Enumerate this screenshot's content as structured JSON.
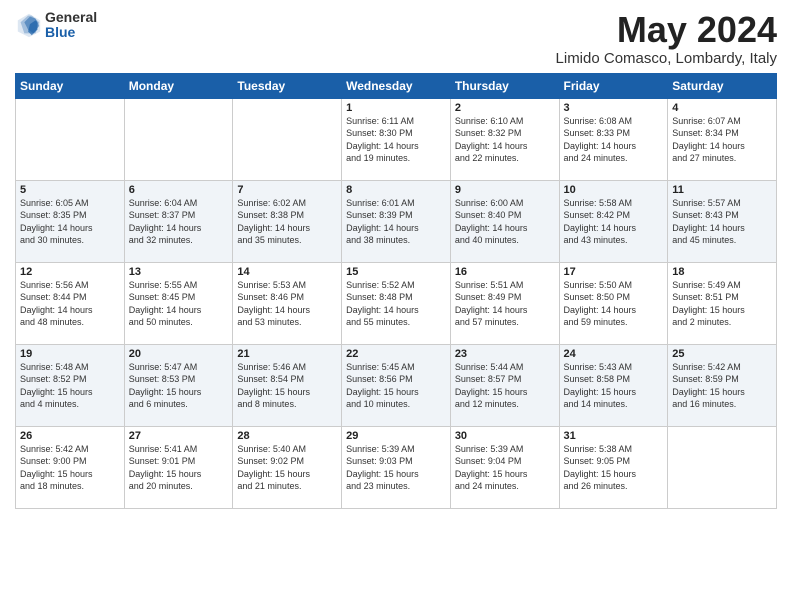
{
  "logo": {
    "general": "General",
    "blue": "Blue"
  },
  "title": {
    "month_year": "May 2024",
    "location": "Limido Comasco, Lombardy, Italy"
  },
  "days_of_week": [
    "Sunday",
    "Monday",
    "Tuesday",
    "Wednesday",
    "Thursday",
    "Friday",
    "Saturday"
  ],
  "weeks": [
    [
      {
        "day": "",
        "info": ""
      },
      {
        "day": "",
        "info": ""
      },
      {
        "day": "",
        "info": ""
      },
      {
        "day": "1",
        "info": "Sunrise: 6:11 AM\nSunset: 8:30 PM\nDaylight: 14 hours\nand 19 minutes."
      },
      {
        "day": "2",
        "info": "Sunrise: 6:10 AM\nSunset: 8:32 PM\nDaylight: 14 hours\nand 22 minutes."
      },
      {
        "day": "3",
        "info": "Sunrise: 6:08 AM\nSunset: 8:33 PM\nDaylight: 14 hours\nand 24 minutes."
      },
      {
        "day": "4",
        "info": "Sunrise: 6:07 AM\nSunset: 8:34 PM\nDaylight: 14 hours\nand 27 minutes."
      }
    ],
    [
      {
        "day": "5",
        "info": "Sunrise: 6:05 AM\nSunset: 8:35 PM\nDaylight: 14 hours\nand 30 minutes."
      },
      {
        "day": "6",
        "info": "Sunrise: 6:04 AM\nSunset: 8:37 PM\nDaylight: 14 hours\nand 32 minutes."
      },
      {
        "day": "7",
        "info": "Sunrise: 6:02 AM\nSunset: 8:38 PM\nDaylight: 14 hours\nand 35 minutes."
      },
      {
        "day": "8",
        "info": "Sunrise: 6:01 AM\nSunset: 8:39 PM\nDaylight: 14 hours\nand 38 minutes."
      },
      {
        "day": "9",
        "info": "Sunrise: 6:00 AM\nSunset: 8:40 PM\nDaylight: 14 hours\nand 40 minutes."
      },
      {
        "day": "10",
        "info": "Sunrise: 5:58 AM\nSunset: 8:42 PM\nDaylight: 14 hours\nand 43 minutes."
      },
      {
        "day": "11",
        "info": "Sunrise: 5:57 AM\nSunset: 8:43 PM\nDaylight: 14 hours\nand 45 minutes."
      }
    ],
    [
      {
        "day": "12",
        "info": "Sunrise: 5:56 AM\nSunset: 8:44 PM\nDaylight: 14 hours\nand 48 minutes."
      },
      {
        "day": "13",
        "info": "Sunrise: 5:55 AM\nSunset: 8:45 PM\nDaylight: 14 hours\nand 50 minutes."
      },
      {
        "day": "14",
        "info": "Sunrise: 5:53 AM\nSunset: 8:46 PM\nDaylight: 14 hours\nand 53 minutes."
      },
      {
        "day": "15",
        "info": "Sunrise: 5:52 AM\nSunset: 8:48 PM\nDaylight: 14 hours\nand 55 minutes."
      },
      {
        "day": "16",
        "info": "Sunrise: 5:51 AM\nSunset: 8:49 PM\nDaylight: 14 hours\nand 57 minutes."
      },
      {
        "day": "17",
        "info": "Sunrise: 5:50 AM\nSunset: 8:50 PM\nDaylight: 14 hours\nand 59 minutes."
      },
      {
        "day": "18",
        "info": "Sunrise: 5:49 AM\nSunset: 8:51 PM\nDaylight: 15 hours\nand 2 minutes."
      }
    ],
    [
      {
        "day": "19",
        "info": "Sunrise: 5:48 AM\nSunset: 8:52 PM\nDaylight: 15 hours\nand 4 minutes."
      },
      {
        "day": "20",
        "info": "Sunrise: 5:47 AM\nSunset: 8:53 PM\nDaylight: 15 hours\nand 6 minutes."
      },
      {
        "day": "21",
        "info": "Sunrise: 5:46 AM\nSunset: 8:54 PM\nDaylight: 15 hours\nand 8 minutes."
      },
      {
        "day": "22",
        "info": "Sunrise: 5:45 AM\nSunset: 8:56 PM\nDaylight: 15 hours\nand 10 minutes."
      },
      {
        "day": "23",
        "info": "Sunrise: 5:44 AM\nSunset: 8:57 PM\nDaylight: 15 hours\nand 12 minutes."
      },
      {
        "day": "24",
        "info": "Sunrise: 5:43 AM\nSunset: 8:58 PM\nDaylight: 15 hours\nand 14 minutes."
      },
      {
        "day": "25",
        "info": "Sunrise: 5:42 AM\nSunset: 8:59 PM\nDaylight: 15 hours\nand 16 minutes."
      }
    ],
    [
      {
        "day": "26",
        "info": "Sunrise: 5:42 AM\nSunset: 9:00 PM\nDaylight: 15 hours\nand 18 minutes."
      },
      {
        "day": "27",
        "info": "Sunrise: 5:41 AM\nSunset: 9:01 PM\nDaylight: 15 hours\nand 20 minutes."
      },
      {
        "day": "28",
        "info": "Sunrise: 5:40 AM\nSunset: 9:02 PM\nDaylight: 15 hours\nand 21 minutes."
      },
      {
        "day": "29",
        "info": "Sunrise: 5:39 AM\nSunset: 9:03 PM\nDaylight: 15 hours\nand 23 minutes."
      },
      {
        "day": "30",
        "info": "Sunrise: 5:39 AM\nSunset: 9:04 PM\nDaylight: 15 hours\nand 24 minutes."
      },
      {
        "day": "31",
        "info": "Sunrise: 5:38 AM\nSunset: 9:05 PM\nDaylight: 15 hours\nand 26 minutes."
      },
      {
        "day": "",
        "info": ""
      }
    ]
  ]
}
